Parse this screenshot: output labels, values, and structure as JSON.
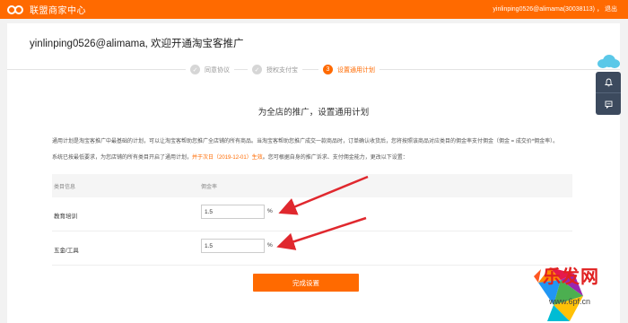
{
  "topbar": {
    "brand": "联盟商家中心",
    "user_text": "yinlinping0526@alimama(30038113)",
    "sep": "，",
    "logout": "退出",
    "color": "#ff6a00"
  },
  "welcome": "yinlinping0526@alimama, 欢迎开通淘宝客推广",
  "steps": [
    {
      "label": "同意协议",
      "status": "done",
      "marker": "✓"
    },
    {
      "label": "授权支付宝",
      "status": "done",
      "marker": "✓"
    },
    {
      "label": "设置通用计划",
      "status": "active",
      "marker": "3"
    }
  ],
  "section_title": "为全店的推广，设置通用计划",
  "desc": {
    "line1": "通用计划是淘宝客推广中最基础的计划，可以让淘宝客帮助您推广全店铺的所有商品。当淘宝客帮助您推广成交一款商品时，订单确认收货后，您将按照该商品对应类目的佣金率支付佣金（佣金 = 成交价*佣金率）。",
    "line2_pre": "系统已按最低要求，为您店铺的所有类目开启了通用计划，",
    "line2_hl": "并于次日（2019-12-01）生效",
    "line2_post": "。您可根据自身的推广诉求、支付佣金能力，更改以下设置："
  },
  "table": {
    "headers": [
      "类目信息",
      "佣金率"
    ],
    "rows": [
      {
        "category": "教育培训",
        "rate": "1.5",
        "unit": "%"
      },
      {
        "category": "五金/工具",
        "rate": "1.5",
        "unit": "%"
      }
    ]
  },
  "finish_button": "完成设置",
  "side": {
    "bell_icon": "bell-icon",
    "chat_icon": "chat-icon"
  },
  "watermark": {
    "text": "乐发网",
    "url": "www.6pf.cn"
  }
}
